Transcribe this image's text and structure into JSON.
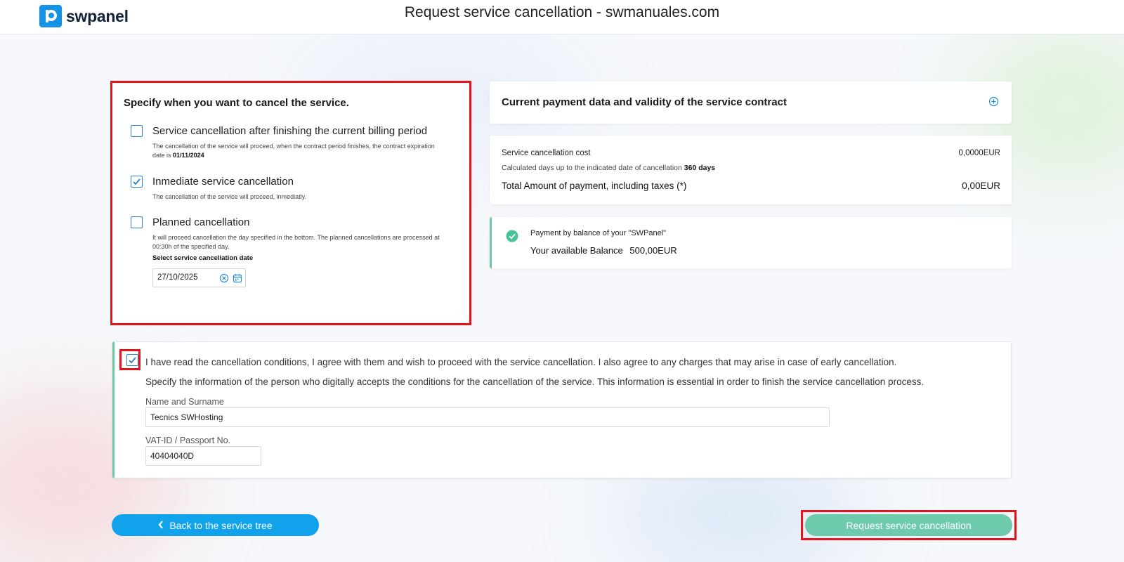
{
  "header": {
    "logo_text": "swpanel",
    "title": "Request service cancellation - swmanuales.com"
  },
  "cancel_options": {
    "heading": "Specify when you want to cancel the service.",
    "option1": {
      "label": "Service cancellation after finishing the current billing period",
      "desc": "The cancellation of the service will proceed, when the contract period finishes, the contract expiration date is",
      "date": "01/11/2024",
      "checked": false
    },
    "option2": {
      "label": "Inmediate service cancellation",
      "desc": "The cancellation of the service will proceed, inmediatly.",
      "checked": true
    },
    "option3": {
      "label": "Planned cancellation",
      "desc": "It will proceed cancellation the day specified in the bottom. The planned cancellations are processed at 00:30h of the specified day.",
      "checked": false
    },
    "date_label": "Select service cancellation date",
    "date_value": "27/10/2025"
  },
  "contract": {
    "title": "Current payment data and validity of the service contract"
  },
  "cost": {
    "label": "Service cancellation cost",
    "value": "0,0000EUR",
    "days_text": "Calculated days up to the indicated date of cancellation",
    "days_value": "360 days",
    "total_label": "Total Amount of payment, including taxes (*)",
    "total_value": "0,00EUR"
  },
  "balance": {
    "subtitle": "Payment by balance of your \"SWPanel\"",
    "label": "Your available Balance",
    "amount": "500,00EUR"
  },
  "conditions": {
    "checked": true,
    "agree_text": "I have read the cancellation conditions, I agree with them and wish to proceed with the service cancellation. I also agree to any charges that may arise in case of early cancellation.",
    "info_text": "Specify the information of the person who digitally accepts the conditions for the cancellation of the service. This information is essential in order to finish the service cancellation process.",
    "name_label": "Name and Surname",
    "name_value": "Tecnics SWHosting",
    "vat_label": "VAT-ID / Passport No.",
    "vat_value": "40404040D"
  },
  "buttons": {
    "back": "Back to the service tree",
    "request": "Request service cancellation"
  },
  "colors": {
    "accent_blue": "#10a3ec",
    "accent_green": "#6dcaad",
    "highlight_red": "#e5141b"
  }
}
